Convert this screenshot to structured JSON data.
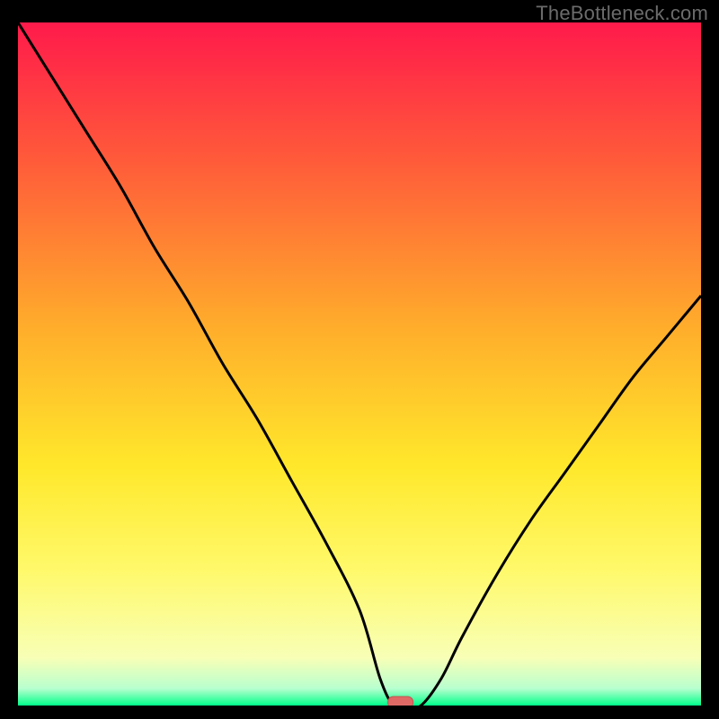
{
  "watermark": "TheBottleneck.com",
  "colors": {
    "bg": "#000000",
    "curve": "#000000",
    "marker_fill": "#df6a65",
    "marker_stroke": "#c05551",
    "grad_stops": [
      {
        "offset": 0.0,
        "color": "#ff1a4b"
      },
      {
        "offset": 0.2,
        "color": "#ff5a3a"
      },
      {
        "offset": 0.45,
        "color": "#ffae2b"
      },
      {
        "offset": 0.65,
        "color": "#ffe82b"
      },
      {
        "offset": 0.8,
        "color": "#fff96a"
      },
      {
        "offset": 0.93,
        "color": "#f8ffb6"
      },
      {
        "offset": 0.975,
        "color": "#b8ffcf"
      },
      {
        "offset": 1.0,
        "color": "#00ff8a"
      }
    ]
  },
  "chart_data": {
    "type": "line",
    "title": "",
    "xlabel": "",
    "ylabel": "",
    "xlim": [
      0,
      100
    ],
    "ylim": [
      0,
      100
    ],
    "annotations": [
      "TheBottleneck.com"
    ],
    "series": [
      {
        "name": "bottleneck-curve",
        "x": [
          0,
          5,
          10,
          15,
          20,
          25,
          30,
          35,
          40,
          45,
          50,
          53,
          55,
          57,
          59,
          62,
          65,
          70,
          75,
          80,
          85,
          90,
          95,
          100
        ],
        "y": [
          100,
          92,
          84,
          76,
          67,
          59,
          50,
          42,
          33,
          24,
          14,
          4,
          0,
          0,
          0,
          4,
          10,
          19,
          27,
          34,
          41,
          48,
          54,
          60
        ]
      }
    ],
    "marker": {
      "x": 56,
      "y": 0
    }
  }
}
